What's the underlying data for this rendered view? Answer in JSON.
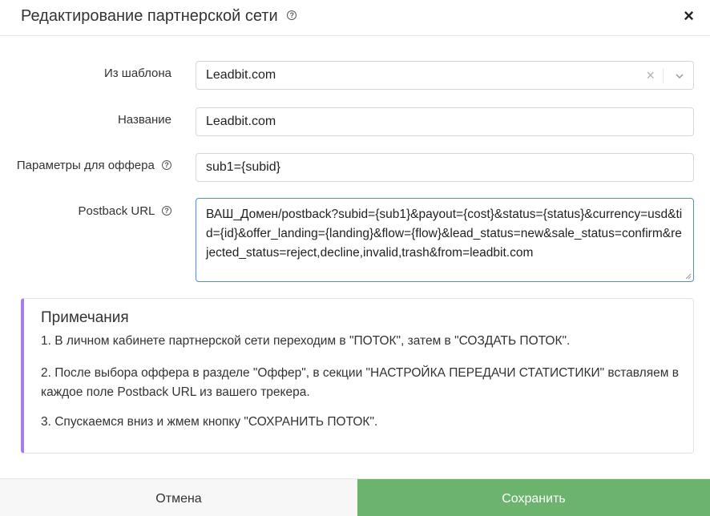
{
  "header": {
    "title": "Редактирование партнерской сети",
    "close": "×"
  },
  "form": {
    "template": {
      "label": "Из шаблона",
      "value": "Leadbit.com"
    },
    "name": {
      "label": "Название",
      "value": "Leadbit.com"
    },
    "offer_params": {
      "label": "Параметры для оффера",
      "value": "sub1={subid}"
    },
    "postback": {
      "label": "Postback URL",
      "value": "ВАШ_Домен/postback?subid={sub1}&payout={cost}&status={status}&currency=usd&tid={id}&offer_landing={landing}&flow={flow}&lead_status=new&sale_status=confirm&rejected_status=reject,decline,invalid,trash&from=leadbit.com"
    }
  },
  "notes": {
    "title": "Примечания",
    "items": [
      "1. В личном кабинете партнерской сети переходим в \"ПОТОК\", затем в \"СОЗДАТЬ ПОТОК\".",
      "2. После выбора оффера в разделе \"Оффер\", в секции \"НАСТРОЙКА ПЕРЕДАЧИ СТАТИСТИКИ\" вставляем в каждое поле Postback URL из вашего трекера.",
      "3. Спускаемся вниз и жмем кнопку \"СОХРАНИТЬ ПОТОК\"."
    ]
  },
  "footer": {
    "cancel": "Отмена",
    "save": "Сохранить"
  },
  "colors": {
    "accent_save": "#6cb36d",
    "notes_border": "#a77de6",
    "focus_border": "#4a90e2"
  }
}
